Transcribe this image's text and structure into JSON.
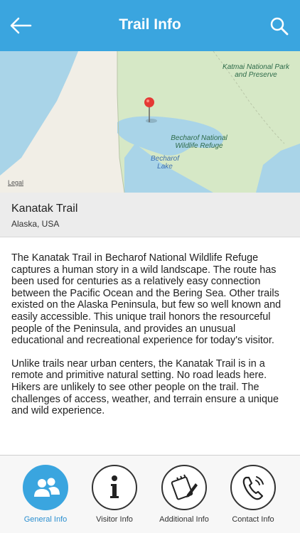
{
  "header": {
    "title": "Trail Info",
    "back_icon": "arrow-left-icon",
    "search_icon": "search-icon",
    "background": "#3aa5df"
  },
  "map": {
    "labels": {
      "katmai": "Katmai National Park and Preserve",
      "becharof_refuge": "Becharof National Wildlife Refuge",
      "becharof_lake": "Becharof Lake"
    },
    "legal": "Legal",
    "pin_icon": "map-pin-icon"
  },
  "trail": {
    "name": "Kanatak Trail",
    "location": "Alaska, USA"
  },
  "description": {
    "p1": "The Kanatak Trail in Becharof National Wildlife Refuge captures a human story in a wild landscape. The route has been used for centuries as a relatively easy connection between the Pacific Ocean and the Bering Sea. Other trails existed on the Alaska Peninsula, but few so well known and easily accessible. This unique trail honors the resourceful people of the Peninsula, and provides an unusual educational and recreational experience for today's visitor.",
    "p2": "Unlike trails near urban centers, the Kanatak Trail is in a remote and primitive natural setting. No road leads here. Hikers are unlikely to see other people on the trail. The challenges of access, weather, and terrain ensure a unique and wild experience."
  },
  "tabs": [
    {
      "label": "General Info",
      "icon": "people-icon",
      "active": true
    },
    {
      "label": "Visitor Info",
      "icon": "info-icon",
      "active": false
    },
    {
      "label": "Additional Info",
      "icon": "notepad-pencil-icon",
      "active": false
    },
    {
      "label": "Contact Info",
      "icon": "phone-icon",
      "active": false
    }
  ]
}
